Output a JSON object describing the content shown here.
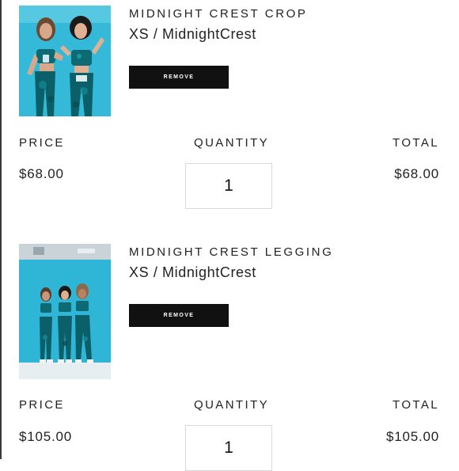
{
  "cart": {
    "items": [
      {
        "name": "MIDNIGHT CREST CROP",
        "variant": "XS / MidnightCrest",
        "remove_label": "REMOVE",
        "price_label": "PRICE",
        "quantity_label": "QUANTITY",
        "total_label": "TOTAL",
        "price": "$68.00",
        "quantity": "1",
        "total": "$68.00"
      },
      {
        "name": "MIDNIGHT CREST LEGGING",
        "variant": "XS / MidnightCrest",
        "remove_label": "REMOVE",
        "price_label": "PRICE",
        "quantity_label": "QUANTITY",
        "total_label": "TOTAL",
        "price": "$105.00",
        "quantity": "1",
        "total": "$105.00"
      }
    ]
  },
  "colors": {
    "button_bg": "#111111",
    "button_text": "#ffffff",
    "text": "#222222",
    "input_border": "#d9d9d9",
    "photo_backdrop": "#2bb7d6",
    "outfit_teal": "#0f6f78"
  }
}
